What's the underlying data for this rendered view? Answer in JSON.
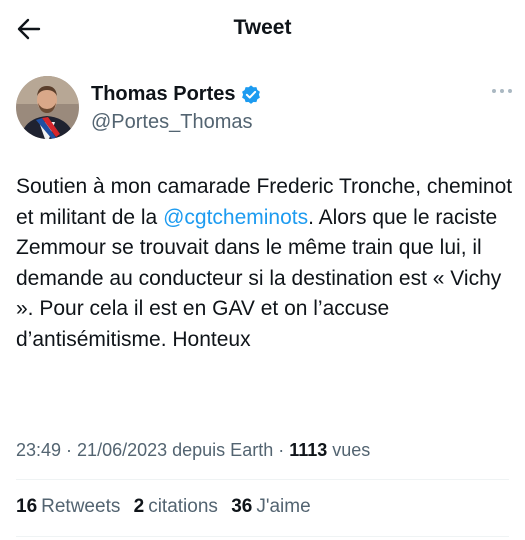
{
  "header": {
    "title": "Tweet"
  },
  "author": {
    "name": "Thomas Portes",
    "handle": "@Portes_Thomas"
  },
  "tweet": {
    "text_before": "Soutien à mon camarade Frederic Tronche, cheminot et militant de la ",
    "mention": "@cgtcheminots",
    "text_after": ". Alors que le raciste Zemmour se trouvait dans le même train que lui, il demande au conducteur si la destination est « Vichy ». Pour cela il est en GAV et on l’accuse d’antisémitisme. Honteux"
  },
  "meta": {
    "time": "23:49",
    "sep1": " · ",
    "date": "21/06/2023",
    "source": " depuis Earth",
    "sep2": " · ",
    "views_count": "1113",
    "views_label": " vues"
  },
  "stats": {
    "retweets": {
      "count": "16",
      "label": "Retweets"
    },
    "quotes": {
      "count": "2",
      "label": "citations"
    },
    "likes": {
      "count": "36",
      "label": "J'aime"
    }
  },
  "colors": {
    "accent": "#1d9bf0",
    "text": "#0f1419",
    "muted": "#536471",
    "divider": "#eff3f4"
  },
  "icons": {
    "back": "arrow-left-icon",
    "verified": "verified-badge-icon",
    "more": "more-horizontal-icon"
  }
}
